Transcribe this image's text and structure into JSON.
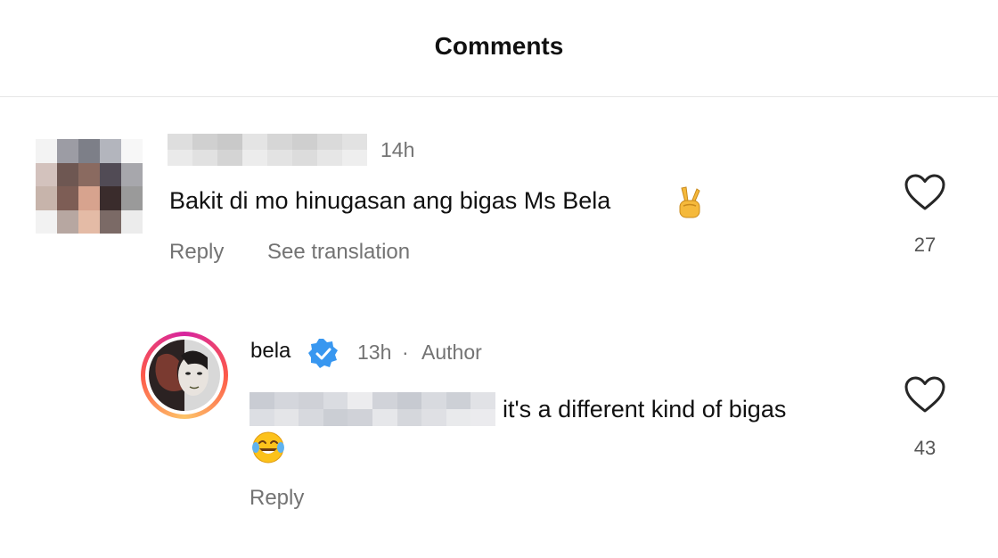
{
  "header": {
    "title": "Comments"
  },
  "comments": [
    {
      "time": "14h",
      "text": "Bakit di mo hinugasan ang bigas Ms Bela",
      "emoji": "peace-sign-emoji",
      "actions": {
        "reply": "Reply",
        "translate": "See translation"
      },
      "likes": "27"
    }
  ],
  "reply": {
    "username": "bela",
    "time": "13h",
    "separator": "·",
    "role": "Author",
    "text": "it's a different kind of bigas",
    "emoji": "tears-of-joy-emoji",
    "actions": {
      "reply": "Reply"
    },
    "likes": "43"
  },
  "colors": {
    "muted": "#737373",
    "verified_blue": "#3897f0",
    "divider": "#e6e6e6"
  }
}
